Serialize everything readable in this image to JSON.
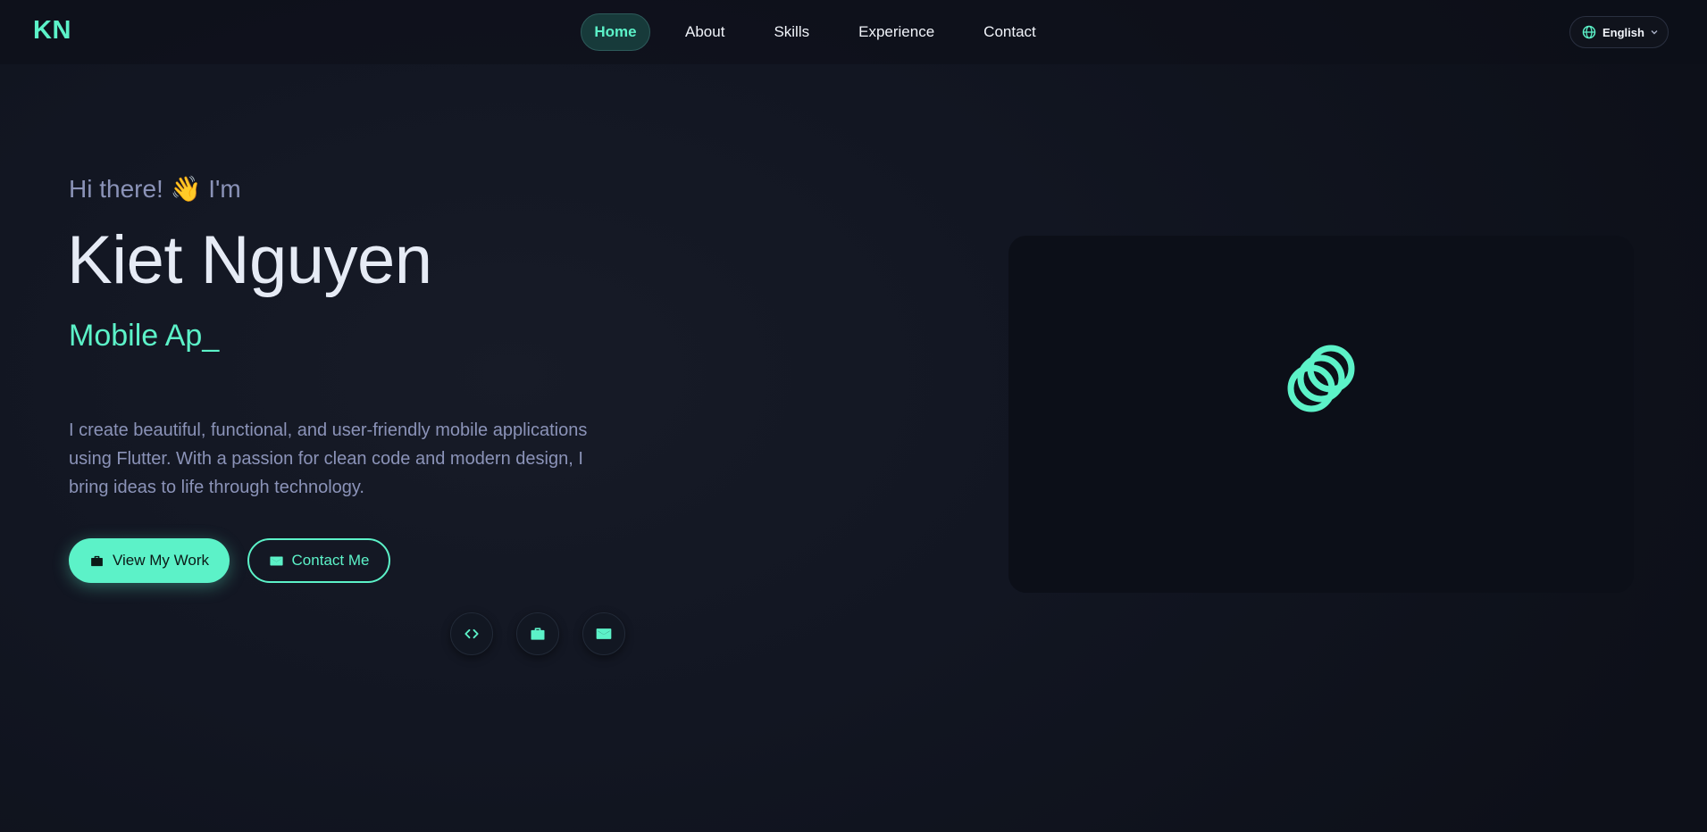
{
  "nav": {
    "logo": "KN",
    "items": [
      {
        "label": "Home",
        "active": true
      },
      {
        "label": "About",
        "active": false
      },
      {
        "label": "Skills",
        "active": false
      },
      {
        "label": "Experience",
        "active": false
      },
      {
        "label": "Contact",
        "active": false
      }
    ],
    "language": {
      "label": "English",
      "icon": "globe-icon"
    }
  },
  "hero": {
    "greeting": "Hi there! 👋 I'm",
    "name": "Kiet Nguyen",
    "role_typed": "Mobile Ap_",
    "description": "I create beautiful, functional, and user-friendly mobile applications using Flutter. With a passion for clean code and modern design, I bring ideas to life through technology.",
    "buttons": {
      "primary": {
        "label": "View My Work",
        "icon": "briefcase-icon"
      },
      "secondary": {
        "label": "Contact Me",
        "icon": "mail-icon"
      }
    },
    "social": [
      {
        "icon": "code-icon"
      },
      {
        "icon": "briefcase-icon"
      },
      {
        "icon": "mail-icon"
      }
    ]
  },
  "media": {
    "loader_icon": "loading-rings-icon"
  },
  "colors": {
    "accent": "#5cf2c8",
    "background": "#121622",
    "text_primary": "#e6ebf5",
    "text_muted": "#8b93b8"
  }
}
